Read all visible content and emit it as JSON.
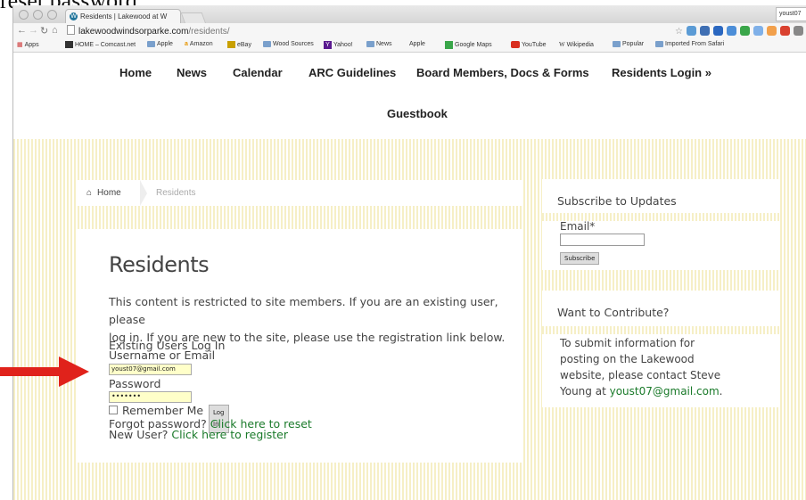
{
  "document": {
    "caption_fragment": "reset password."
  },
  "browser": {
    "tab_title": "Residents | Lakewood at W",
    "user_badge": "youst07",
    "url_host": "lakewoodwindsorparke.com",
    "url_path": "/residents/",
    "bookmarks": [
      "Apps",
      "HOME – Comcast.net",
      "Apple",
      "Amazon",
      "eBay",
      "Wood Sources",
      "Yahoo!",
      "News",
      "Apple",
      "Google Maps",
      "YouTube",
      "Wikipedia",
      "Popular",
      "Imported From Safari"
    ]
  },
  "site": {
    "menu": [
      "Home",
      "News",
      "Calendar",
      "ARC Guidelines",
      "Board Members, Docs & Forms",
      "Residents Login »",
      "Guestbook"
    ],
    "breadcrumb": {
      "home": "Home",
      "current": "Residents"
    }
  },
  "content": {
    "title": "Residents",
    "intro_line1": "This content is restricted to site members. If you are an existing user, please",
    "intro_line2": "log in. If you are new to the site, please use the registration link below.",
    "login": {
      "heading": "Existing Users Log In",
      "username_label": "Username or Email",
      "username_value": "youst07@gmail.com",
      "password_label": "Password",
      "password_value": "•••••••",
      "remember_label": "Remember Me",
      "login_button": "Log In",
      "forgot_prefix": "Forgot password?",
      "forgot_link": "Click here to reset",
      "new_user_prefix": "New User?",
      "register_link": "Click here to register"
    }
  },
  "sidebar": {
    "subscribe": {
      "title": "Subscribe to Updates",
      "email_label": "Email*",
      "button": "Subscribe"
    },
    "contribute": {
      "title": "Want to Contribute?",
      "line1": "To submit information for",
      "line2": "posting on the Lakewood",
      "line3": "website, please contact Steve",
      "line4_prefix": "Young at",
      "email": "youst07@gmail.com",
      "period": "."
    }
  },
  "colors": {
    "arrow": "#e0221b",
    "link": "#1a7a2a",
    "stripe": "#f6efc6",
    "field_fill": "#ffffc9"
  },
  "icons": [
    "back-arrow-icon",
    "forward-arrow-icon",
    "reload-icon",
    "home-icon",
    "page-icon",
    "bookmark-star-icon",
    "wordpress-icon",
    "folder-icon",
    "house-icon"
  ]
}
